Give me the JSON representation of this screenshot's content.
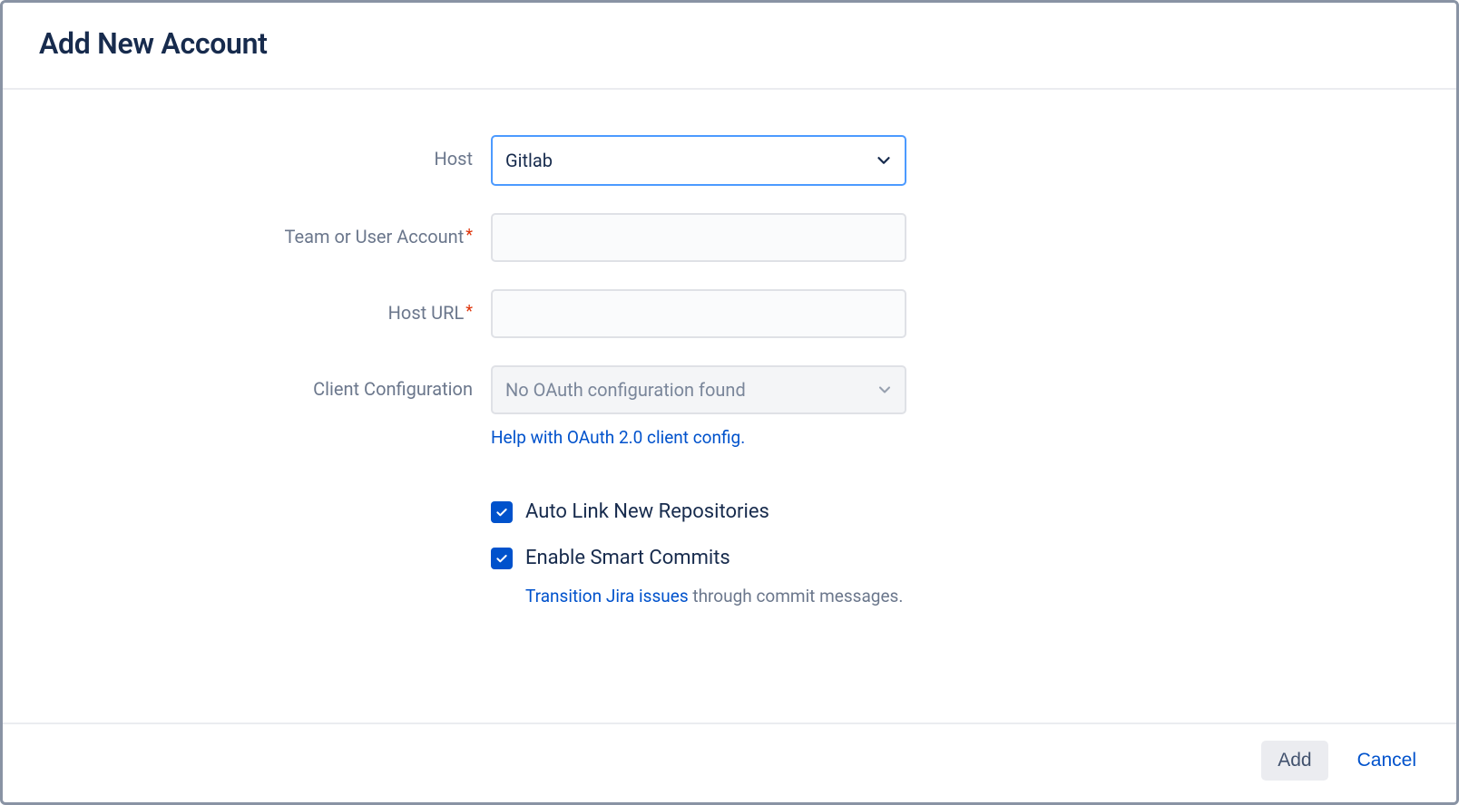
{
  "dialog": {
    "title": "Add New Account"
  },
  "form": {
    "host": {
      "label": "Host",
      "value": "Gitlab"
    },
    "team_or_user": {
      "label": "Team or User Account",
      "value": ""
    },
    "host_url": {
      "label": "Host URL",
      "value": ""
    },
    "client_config": {
      "label": "Client Configuration",
      "value": "No OAuth configuration found",
      "help_link": "Help with OAuth 2.0 client config."
    },
    "auto_link": {
      "label": "Auto Link New Repositories",
      "checked": true
    },
    "smart_commits": {
      "label": "Enable Smart Commits",
      "checked": true,
      "hint_link": "Transition Jira issues",
      "hint_rest": " through commit messages."
    }
  },
  "footer": {
    "add": "Add",
    "cancel": "Cancel"
  }
}
